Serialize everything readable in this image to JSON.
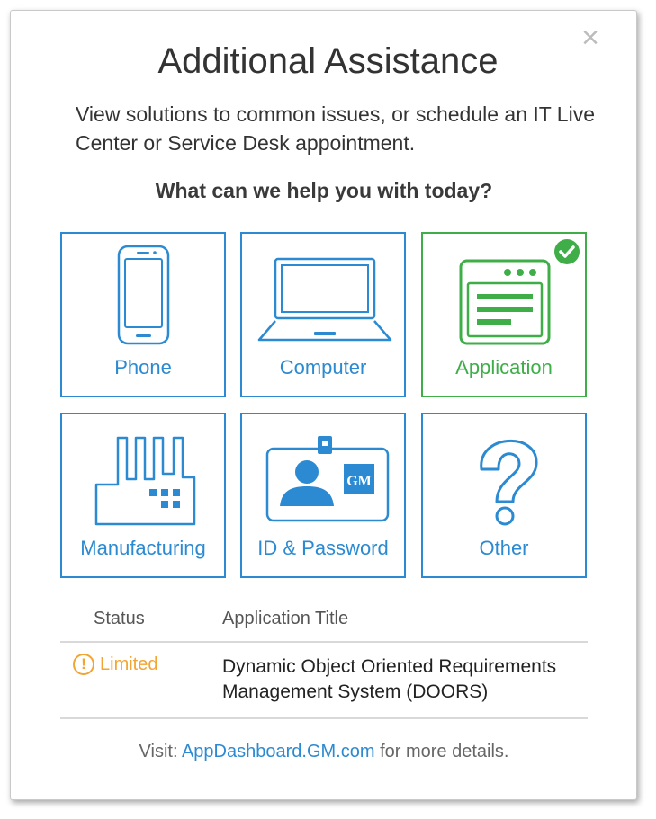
{
  "dialog": {
    "title": "Additional Assistance",
    "close_symbol": "×",
    "subtitle": "View solutions to common issues, or schedule an IT Live Center or Service Desk appointment.",
    "question": "What can we help you with today?"
  },
  "tiles": [
    {
      "label": "Phone",
      "icon": "phone-icon",
      "selected": false
    },
    {
      "label": "Computer",
      "icon": "laptop-icon",
      "selected": false
    },
    {
      "label": "Application",
      "icon": "application-window-icon",
      "selected": true
    },
    {
      "label": "Manufacturing",
      "icon": "factory-icon",
      "selected": false
    },
    {
      "label": "ID & Password",
      "icon": "id-badge-icon",
      "selected": false,
      "badge_text": "GM"
    },
    {
      "label": "Other",
      "icon": "question-mark-icon",
      "selected": false
    }
  ],
  "table": {
    "headers": [
      "Status",
      "Application Title"
    ],
    "rows": [
      {
        "status": "Limited",
        "status_icon": "warning-icon",
        "title": "Dynamic Object Oriented Requirements Management System (DOORS)"
      }
    ]
  },
  "footer": {
    "prefix": "Visit: ",
    "link_text": "AppDashboard.GM.com",
    "suffix": " for more details."
  },
  "colors": {
    "accent_blue": "#2b8ad1",
    "selected_green": "#3fae49",
    "warning_orange": "#f2a531"
  }
}
